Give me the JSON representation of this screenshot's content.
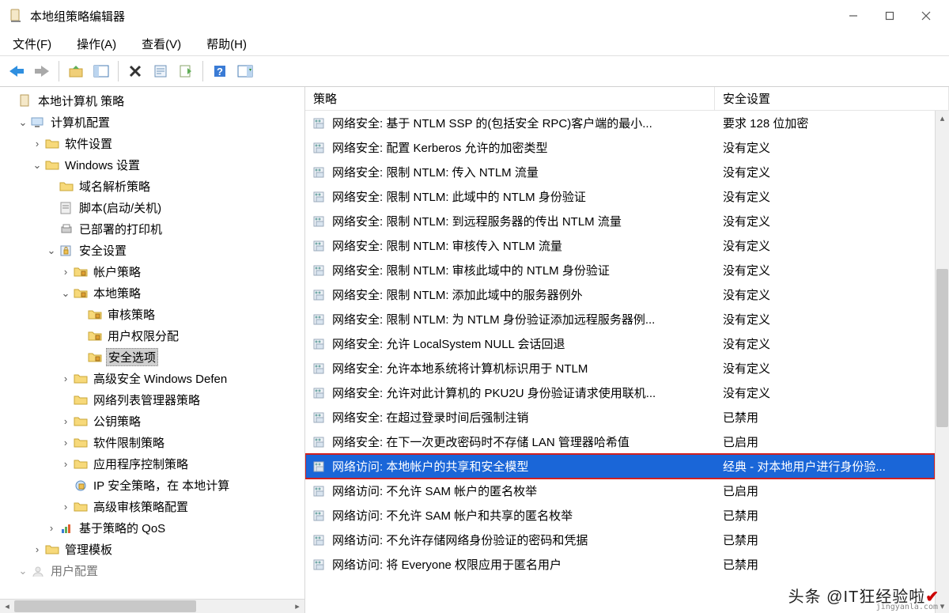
{
  "window": {
    "title": "本地组策略编辑器"
  },
  "menu": {
    "file": "文件(F)",
    "action": "操作(A)",
    "view": "查看(V)",
    "help": "帮助(H)"
  },
  "tree": {
    "root": "本地计算机 策略",
    "n1": "计算机配置",
    "n1_1": "软件设置",
    "n1_2": "Windows 设置",
    "n1_2_1": "域名解析策略",
    "n1_2_2": "脚本(启动/关机)",
    "n1_2_3": "已部署的打印机",
    "n1_2_4": "安全设置",
    "n1_2_4_1": "帐户策略",
    "n1_2_4_2": "本地策略",
    "n1_2_4_2_1": "审核策略",
    "n1_2_4_2_2": "用户权限分配",
    "n1_2_4_2_3": "安全选项",
    "n1_2_4_3": "高级安全 Windows Defen",
    "n1_2_4_4": "网络列表管理器策略",
    "n1_2_4_5": "公钥策略",
    "n1_2_4_6": "软件限制策略",
    "n1_2_4_7": "应用程序控制策略",
    "n1_2_4_8": "IP 安全策略，在 本地计算",
    "n1_2_4_9": "高级审核策略配置",
    "n1_2_5": "基于策略的 QoS",
    "n1_3": "管理模板",
    "n2": "用户配置"
  },
  "columns": {
    "policy": "策略",
    "setting": "安全设置"
  },
  "val": {
    "nd": "没有定义",
    "enabled": "已启用",
    "disabled": "已禁用",
    "enc128": "要求 128 位加密",
    "classic": "经典 - 对本地用户进行身份验..."
  },
  "rows": [
    {
      "p": "网络安全: 基于 NTLM SSP 的(包括安全 RPC)客户端的最小...",
      "s": "enc128"
    },
    {
      "p": "网络安全: 配置 Kerberos 允许的加密类型",
      "s": "nd"
    },
    {
      "p": "网络安全: 限制 NTLM: 传入 NTLM 流量",
      "s": "nd"
    },
    {
      "p": "网络安全: 限制 NTLM: 此域中的 NTLM 身份验证",
      "s": "nd"
    },
    {
      "p": "网络安全: 限制 NTLM: 到远程服务器的传出 NTLM 流量",
      "s": "nd"
    },
    {
      "p": "网络安全: 限制 NTLM: 审核传入 NTLM 流量",
      "s": "nd"
    },
    {
      "p": "网络安全: 限制 NTLM: 审核此域中的 NTLM 身份验证",
      "s": "nd"
    },
    {
      "p": "网络安全: 限制 NTLM: 添加此域中的服务器例外",
      "s": "nd"
    },
    {
      "p": "网络安全: 限制 NTLM: 为 NTLM 身份验证添加远程服务器例...",
      "s": "nd"
    },
    {
      "p": "网络安全: 允许 LocalSystem NULL 会话回退",
      "s": "nd"
    },
    {
      "p": "网络安全: 允许本地系统将计算机标识用于 NTLM",
      "s": "nd"
    },
    {
      "p": "网络安全: 允许对此计算机的 PKU2U 身份验证请求使用联机...",
      "s": "nd"
    },
    {
      "p": "网络安全: 在超过登录时间后强制注销",
      "s": "disabled"
    },
    {
      "p": "网络安全: 在下一次更改密码时不存储 LAN 管理器哈希值",
      "s": "enabled"
    },
    {
      "p": "网络访问: 本地帐户的共享和安全模型",
      "s": "classic",
      "sel": true
    },
    {
      "p": "网络访问: 不允许 SAM 帐户的匿名枚举",
      "s": "enabled"
    },
    {
      "p": "网络访问: 不允许 SAM 帐户和共享的匿名枚举",
      "s": "disabled"
    },
    {
      "p": "网络访问: 不允许存储网络身份验证的密码和凭据",
      "s": "disabled"
    },
    {
      "p": "网络访问: 将 Everyone 权限应用于匿名用户",
      "s": "disabled"
    }
  ],
  "watermark": {
    "main": "头条 @IT狂经验啦",
    "sub": "jingyanla.com"
  }
}
